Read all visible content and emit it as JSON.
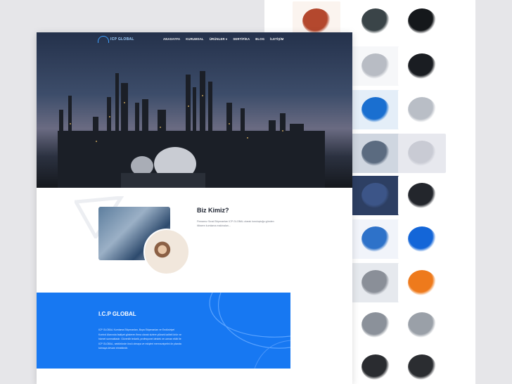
{
  "site": {
    "logo_text": "ICP GLOBAL",
    "nav": [
      "ANASAYFA",
      "KURUMSAL",
      "ÜRÜNLER ▾",
      "SERTİFİKA",
      "BLOG",
      "İLETİŞİM"
    ]
  },
  "about": {
    "title": "Biz Kimiz?",
    "text": "Firmamız Sınai Ekipmanları ICP GLOBAL olarak kuruluştuğu günden itibaren kumlama makinaları..."
  },
  "global": {
    "title": "I.C.P GLOBAL",
    "text": "ICP GLOBAL Kumlama Ekipmanları, Boya Ekipmanları ve Endüstriyel Kontrol Alanında faaliyet gösteren firma olarak sizlere yüksek kaliteli ürün ve hizmet sunmaktadır. Güvenilir tedarik, profesyonel destek ve uzman ekibi ile ICP GLOBAL, sektöründe öncü olmaya ve müşteri memnuniyetini ön planda tutmaya devam etmektedir."
  },
  "products": [
    "red-grit",
    "steel-grit",
    "black-grit",
    "steel-balls",
    "black-granules",
    "blue-machine",
    "nozzle",
    "grey-grit",
    "glass-beads",
    "blue-grit",
    "black-particles",
    "spray-gun-blue",
    "spray-gun-cordless",
    "spray-gun-silver",
    "spray-gun-orange",
    "spray-gun-cup",
    "pressure-regulator",
    "airless-unit",
    "gauge-device"
  ],
  "colors": {
    "accent": "#1778f2",
    "background": "#e6e6e9"
  }
}
